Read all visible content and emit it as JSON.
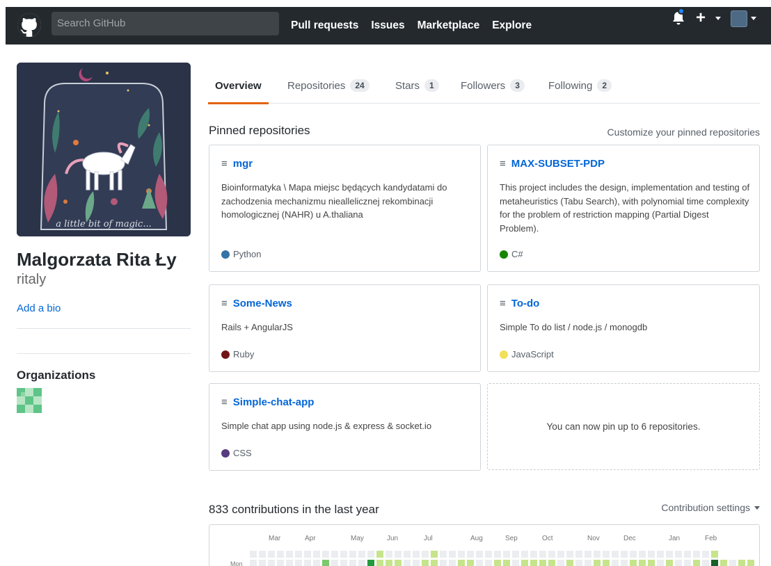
{
  "header": {
    "search_placeholder": "Search GitHub",
    "nav": [
      "Pull requests",
      "Issues",
      "Marketplace",
      "Explore"
    ],
    "plus": "+"
  },
  "profile": {
    "avatar_caption": "a little bit of magic...",
    "fullname": "Malgorzata Rita Ły",
    "username": "ritaly",
    "add_bio": "Add a bio",
    "organizations_title": "Organizations"
  },
  "tabs": [
    {
      "label": "Overview",
      "count": null,
      "selected": true
    },
    {
      "label": "Repositories",
      "count": "24"
    },
    {
      "label": "Stars",
      "count": "1"
    },
    {
      "label": "Followers",
      "count": "3"
    },
    {
      "label": "Following",
      "count": "2"
    }
  ],
  "pinned": {
    "title": "Pinned repositories",
    "customize": "Customize your pinned repositories",
    "repos": [
      {
        "name": "mgr",
        "description": "Bioinformatyka \\ Mapa miejsc będących kandydatami do zachodzenia mechanizmu nieallelicznej rekombinacji homologicznej (NAHR) u A.thaliana",
        "language": "Python",
        "color": "#3572A5"
      },
      {
        "name": "MAX-SUBSET-PDP",
        "description": "This project includes the design, implementation and testing of metaheuristics (Tabu Search), with polynomial time complexity for the problem of restriction mapping (Partial Digest Problem).",
        "language": "C#",
        "color": "#178600"
      },
      {
        "name": "Some-News",
        "description": "Rails + AngularJS",
        "language": "Ruby",
        "color": "#701516"
      },
      {
        "name": "To-do",
        "description": "Simple To do list / node.js / monogdb",
        "language": "JavaScript",
        "color": "#f1e05a"
      },
      {
        "name": "Simple-chat-app",
        "description": "Simple chat app using node.js & express & socket.io",
        "language": "CSS",
        "color": "#563d7c"
      }
    ],
    "empty_message": "You can now pin up to 6 repositories."
  },
  "contributions": {
    "title": "833 contributions in the last year",
    "settings": "Contribution settings",
    "months": [
      "Mar",
      "Apr",
      "May",
      "Jun",
      "Jul",
      "Aug",
      "Sep",
      "Oct",
      "Nov",
      "Dec",
      "Jan",
      "Feb"
    ],
    "day_label": "Mon",
    "colors": [
      "#ebedf0",
      "#c6e48b",
      "#7bc96f",
      "#239a3b",
      "#196127"
    ],
    "row_sun": [
      0,
      0,
      0,
      0,
      0,
      0,
      0,
      0,
      0,
      0,
      0,
      0,
      0,
      0,
      1,
      0,
      0,
      0,
      0,
      0,
      1,
      0,
      0,
      0,
      0,
      0,
      0,
      0,
      0,
      0,
      0,
      0,
      0,
      0,
      0,
      0,
      0,
      0,
      0,
      0,
      0,
      0,
      0,
      0,
      0,
      0,
      0,
      0,
      0,
      0,
      0,
      1
    ],
    "row_mon": [
      0,
      0,
      0,
      0,
      0,
      0,
      0,
      0,
      2,
      0,
      0,
      0,
      0,
      3,
      1,
      1,
      1,
      0,
      0,
      1,
      1,
      0,
      0,
      1,
      1,
      0,
      0,
      1,
      1,
      0,
      1,
      1,
      1,
      1,
      0,
      1,
      0,
      0,
      1,
      1,
      0,
      0,
      1,
      1,
      1,
      0,
      1,
      0,
      0,
      1,
      0,
      4,
      1,
      0,
      1,
      1
    ]
  }
}
